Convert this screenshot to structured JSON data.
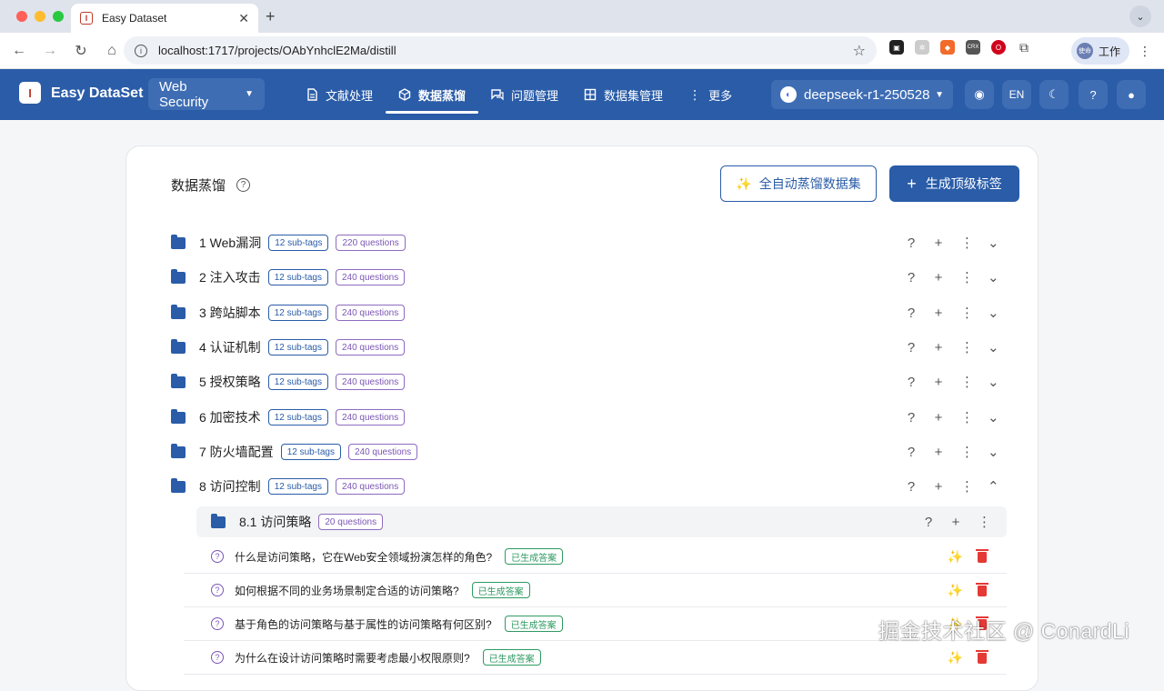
{
  "browser": {
    "tab_title": "Easy Dataset",
    "tab_favicon": "I",
    "url": "localhost:1717/projects/OAbYnhclE2Ma/distill",
    "profile_label": "工作",
    "profile_avatar": "使命"
  },
  "app": {
    "brand": "Easy DataSet",
    "logo_glyph": "I",
    "project": "Web Security",
    "nav": [
      {
        "label": "文献处理",
        "icon": "document-icon"
      },
      {
        "label": "数据蒸馏",
        "icon": "cube-icon",
        "active": true
      },
      {
        "label": "问题管理",
        "icon": "chat-icon"
      },
      {
        "label": "数据集管理",
        "icon": "grid-icon"
      },
      {
        "label": "更多",
        "icon": "more-vertical-icon"
      }
    ],
    "model": "deepseek-r1-250528",
    "language": "EN"
  },
  "main": {
    "title": "数据蒸馏",
    "auto_distill_label": "全自动蒸馏数据集",
    "generate_top_tags_label": "生成顶级标签",
    "tags": [
      {
        "name": "1 Web漏洞",
        "subtags": "12 sub-tags",
        "questions": "220 questions"
      },
      {
        "name": "2 注入攻击",
        "subtags": "12 sub-tags",
        "questions": "240 questions"
      },
      {
        "name": "3 跨站脚本",
        "subtags": "12 sub-tags",
        "questions": "240 questions"
      },
      {
        "name": "4 认证机制",
        "subtags": "12 sub-tags",
        "questions": "240 questions"
      },
      {
        "name": "5 授权策略",
        "subtags": "12 sub-tags",
        "questions": "240 questions"
      },
      {
        "name": "6 加密技术",
        "subtags": "12 sub-tags",
        "questions": "240 questions"
      },
      {
        "name": "7 防火墙配置",
        "subtags": "12 sub-tags",
        "questions": "240 questions"
      },
      {
        "name": "8 访问控制",
        "subtags": "12 sub-tags",
        "questions": "240 questions",
        "expanded": true
      }
    ],
    "subtag": {
      "name": "8.1 访问策略",
      "questions": "20 questions"
    },
    "questions": [
      {
        "text": "什么是访问策略，它在Web安全领域扮演怎样的角色?",
        "status": "已生成答案"
      },
      {
        "text": "如何根据不同的业务场景制定合适的访问策略?",
        "status": "已生成答案"
      },
      {
        "text": "基于角色的访问策略与基于属性的访问策略有何区别?",
        "status": "已生成答案"
      },
      {
        "text": "为什么在设计访问策略时需要考虑最小权限原则?",
        "status": "已生成答案"
      }
    ]
  },
  "watermark": "掘金技术社区 @ ConardLi",
  "colors": {
    "primary": "#2a5ca8",
    "purple": "#7b56b5",
    "green": "#2e9a62",
    "danger": "#e53935"
  }
}
